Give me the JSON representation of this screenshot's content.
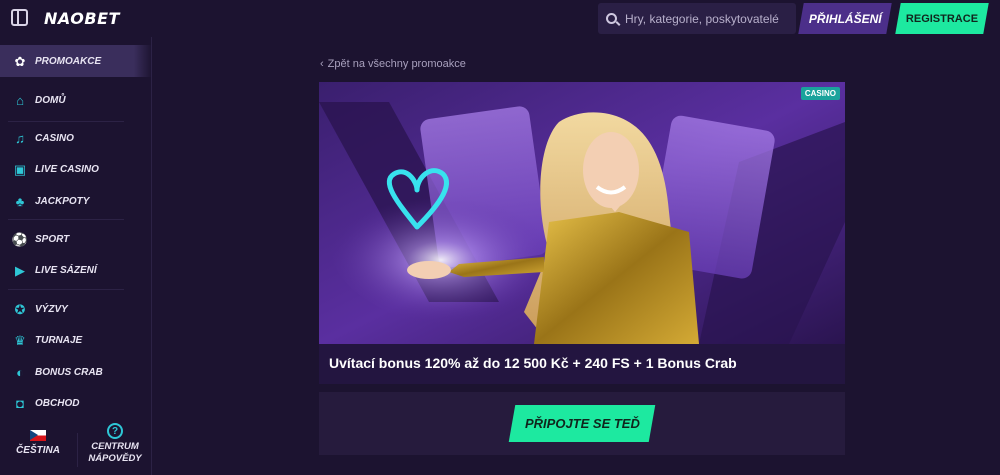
{
  "header": {
    "logo": "NAOBET",
    "search_placeholder": "Hry, kategorie, poskytovatelé",
    "login_label": "PŘIHLÁŠENÍ",
    "register_label": "REGISTRACE"
  },
  "sidebar": {
    "promo": {
      "label": "PROMOAKCE",
      "icon": "gift-icon"
    },
    "items": [
      {
        "label": "DOMŮ",
        "icon": "home-icon"
      },
      {
        "label": "CASINO",
        "icon": "music-note-icon"
      },
      {
        "label": "LIVE CASINO",
        "icon": "cards-icon"
      },
      {
        "label": "JACKPOTY",
        "icon": "clover-icon"
      },
      {
        "label": "SPORT",
        "icon": "sport-icon"
      },
      {
        "label": "LIVE SÁZENÍ",
        "icon": "live-icon"
      },
      {
        "label": "VÝZVY",
        "icon": "medal-icon"
      },
      {
        "label": "TURNAJE",
        "icon": "trophy-icon"
      },
      {
        "label": "BONUS CRAB",
        "icon": "crab-icon"
      },
      {
        "label": "OBCHOD",
        "icon": "shop-bag-icon"
      }
    ],
    "language_label": "ČEŠTINA",
    "help_label_line1": "CENTRUM",
    "help_label_line2": "NÁPOVĚDY"
  },
  "main": {
    "back_link": "Zpět na všechny promoakce",
    "badge": "CASINO",
    "promo_title": "Uvítací bonus 120% až do 12 500 Kč + 240 FS + 1 Bonus Crab",
    "cta_label": "PŘIPOJTE SE TEĎ"
  },
  "colors": {
    "background": "#1c1330",
    "accent_green": "#1de9a0",
    "accent_purple": "#4c2f8a",
    "icon_teal": "#2ec7d6"
  }
}
